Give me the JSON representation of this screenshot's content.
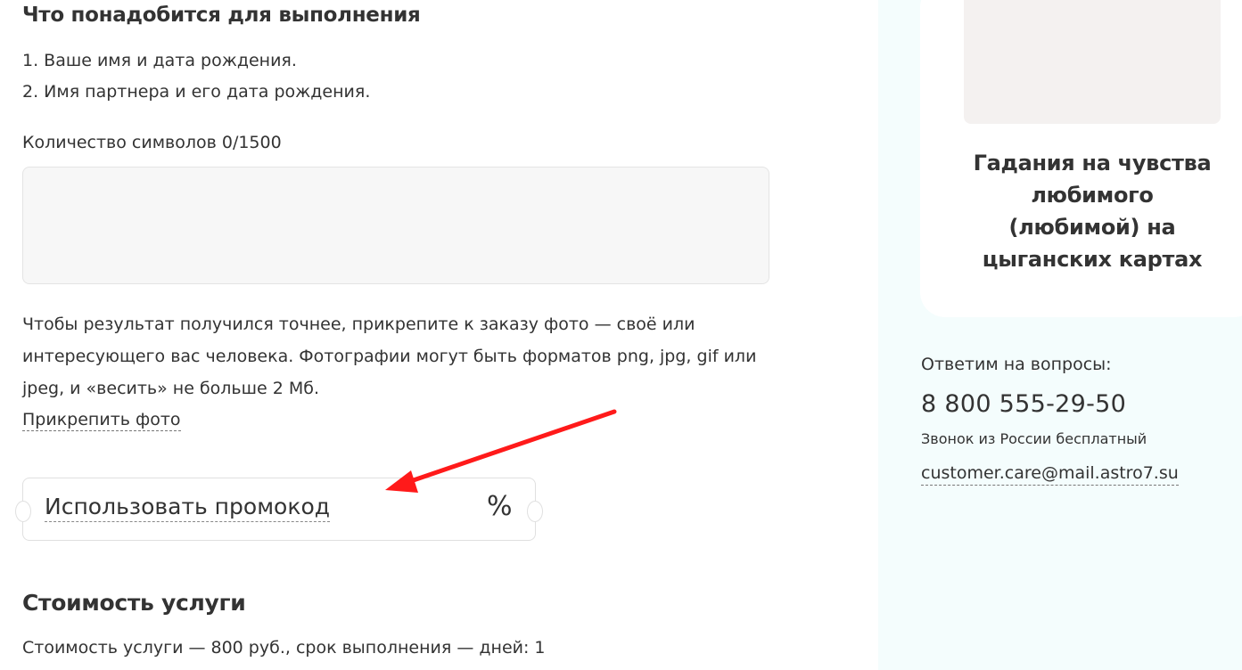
{
  "requirements": {
    "title": "Что понадобится для выполнения",
    "items": [
      "1. Ваше имя и дата рождения.",
      "2. Имя партнера и его дата рождения."
    ]
  },
  "message": {
    "counter_label": "Количество символов 0/1500",
    "value": ""
  },
  "photo": {
    "hint": "Чтобы результат получился точнее, прикрепите к заказу фото — своё или интересующего вас человека. Фотографии могут быть форматов png, jpg, gif или jpeg, и «весить» не больше 2 Мб.",
    "attach_label": "Прикрепить фото"
  },
  "promo": {
    "label": "Использовать промокод",
    "icon": "percent-icon",
    "icon_glyph": "%"
  },
  "price": {
    "title": "Стоимость услуги",
    "text": "Стоимость услуги — 800 руб., срок выполнения — дней: 1"
  },
  "sidebar": {
    "card_title": "Гадания на чувства любимого (любимой) на цыганских картах",
    "contacts": {
      "label": "Ответим на вопросы:",
      "phone": "8 800 555-29-50",
      "note": "Звонок из России бесплатный",
      "email": "customer.care@mail.astro7.su"
    }
  },
  "colors": {
    "accent_arrow": "#ff1a1a",
    "sidebar_bg": "#f4fdfd",
    "text": "#333333"
  }
}
